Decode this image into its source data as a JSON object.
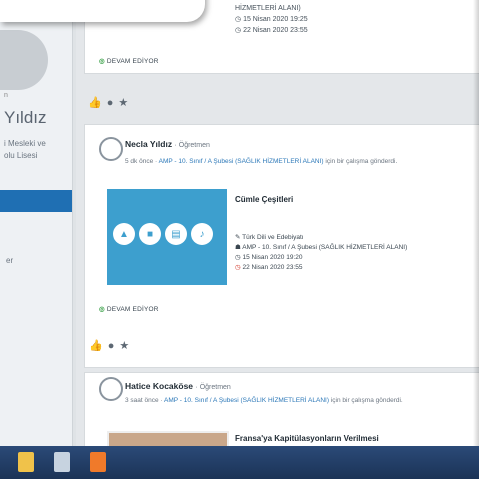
{
  "sidebar": {
    "name_fragment": "Yıldız",
    "small_text": "n",
    "school_line1": "i Mesleki ve",
    "school_line2": "olu Lisesi",
    "menu_fragment": "er"
  },
  "post_top": {
    "assign_tail": "HİZMETLERİ ALANI)",
    "start_date": "15 Nisan 2020 19:25",
    "end_date": "22 Nisan 2020 23:55",
    "status": "DEVAM EDİYOR"
  },
  "post_main": {
    "author": "Necla Yıldız",
    "role": "· Öğretmen",
    "time": "5 dk önce",
    "class_link": "AMP - 10. Sınıf / A Şubesi (SAĞLIK HİZMETLERİ ALANI)",
    "action": "için bir çalışma gönderdi.",
    "topic": "Cümle Çeşitleri",
    "subject": "Türk Dili ve Edebiyatı",
    "class_detail": "AMP - 10. Sınıf / A Şubesi (SAĞLIK HİZMETLERİ ALANI)",
    "start_date": "15 Nisan 2020 19:20",
    "end_date": "22 Nisan 2020 23:55",
    "status": "DEVAM EDİYOR"
  },
  "post_third": {
    "author": "Hatice Kocaköse",
    "role": "· Öğretmen",
    "time": "3 saat önce",
    "class_link": "AMP - 10. Sınıf / A Şubesi (SAĞLIK HİZMETLERİ ALANI)",
    "action": "için bir çalışma gönderdi.",
    "topic": "Fransa'ya Kapitülasyonların Verilmesi"
  },
  "colors": {
    "accent": "#1f6fb3",
    "thumb": "#3d9fce",
    "status_green": "#3ca24a",
    "end_red": "#d33a2c",
    "taskbar": "#2b4a78"
  }
}
